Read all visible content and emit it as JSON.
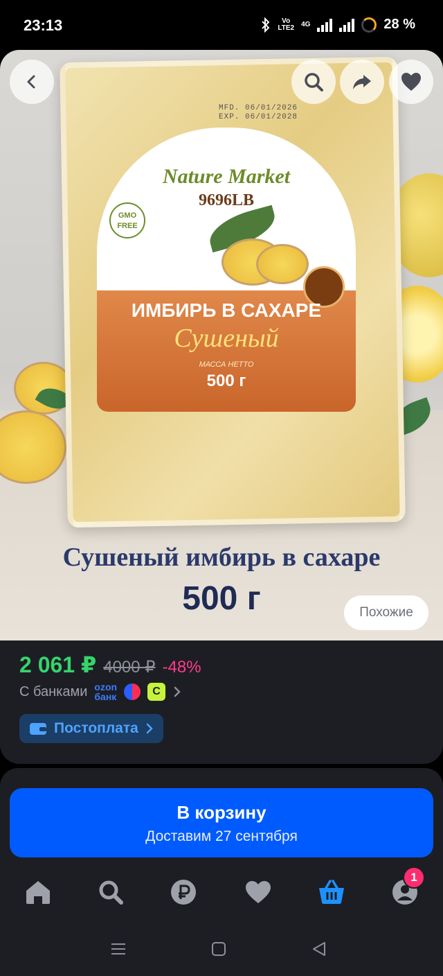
{
  "status_bar": {
    "time": "23:13",
    "network_vo": "Vo",
    "network_lte": "LTE2",
    "network_4g": "4G",
    "battery": "28 %"
  },
  "product_image": {
    "mfd": "MFD. 06/01/2026",
    "exp": "EXP. 06/01/2028",
    "brand": "Nature Market",
    "brand_code": "9696LB",
    "gmo_badge": "GMO FREE",
    "package_name": "ИМБИРЬ В САХАРЕ",
    "package_sub": "Сушеный",
    "net_mass_label": "МАССА НЕТТО",
    "net_weight": "500 г",
    "caption": "Сушеный имбирь в сахаре",
    "caption_weight": "500 г"
  },
  "header_buttons": {
    "back_icon": "chevron-left-icon",
    "search_icon": "search-icon",
    "share_icon": "share-icon",
    "favorite_icon": "heart-icon"
  },
  "similar_button": "Похожие",
  "pricing": {
    "price": "2 061 ₽",
    "old_price": "4000 ₽",
    "discount": "-48%"
  },
  "banks": {
    "label": "С банками",
    "ozon_line1": "ozon",
    "ozon_line2": "банк",
    "bank2_glyph": "C"
  },
  "postpay": {
    "label": "Постоплата"
  },
  "cart": {
    "title": "В корзину",
    "delivery": "Доставим 27 сентября"
  },
  "nav": {
    "items": [
      "home-icon",
      "search-icon",
      "ruble-icon",
      "heart-icon",
      "basket-icon",
      "profile-icon"
    ],
    "profile_badge": "1",
    "active": "basket-icon"
  },
  "colors": {
    "accent": "#005bff",
    "price": "#35d46c",
    "discount": "#ff3c8c",
    "badge": "#ff2d6f"
  }
}
